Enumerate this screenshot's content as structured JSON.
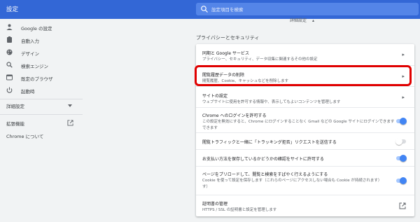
{
  "app": {
    "title": "設定"
  },
  "search": {
    "placeholder": "設定項目を検索",
    "icon": "search-icon"
  },
  "sidebar": {
    "items": [
      {
        "label": "Google の設定",
        "icon": "person-icon"
      },
      {
        "label": "自動入力",
        "icon": "clipboard-icon"
      },
      {
        "label": "デザイン",
        "icon": "palette-icon"
      },
      {
        "label": "検索エンジン",
        "icon": "search-icon"
      },
      {
        "label": "既定のブラウザ",
        "icon": "browser-icon"
      },
      {
        "label": "起動時",
        "icon": "power-icon"
      }
    ],
    "advanced_label": "詳細設定",
    "extensions_label": "拡張機能",
    "about_label": "Chrome について"
  },
  "breadcrumb": {
    "label": "詳細設定",
    "arrow": "▴"
  },
  "privacy": {
    "title": "プライバシーとセキュリティ",
    "rows": [
      {
        "title": "同期と Google サービス",
        "subtitle": "プライバシー、セキュリティ、データ収集に関連するその他の設定",
        "control": "chevron"
      },
      {
        "title": "閲覧履歴データの削除",
        "subtitle": "閲覧履歴、Cookie、キャッシュなどを削除します",
        "control": "chevron",
        "highlighted": true
      },
      {
        "title": "サイトの設定",
        "subtitle": "ウェブサイトに使用を許可する情報や、表示してもよいコンテンツを管理します",
        "control": "chevron"
      },
      {
        "title": "Chrome へのログインを許可する",
        "subtitle": "この設定を無効にすると、Chrome にログインすることなく Gmail などの Google サイトにログインできます",
        "control": "toggle",
        "on": true
      },
      {
        "title": "閲覧トラフィックと一緒に「トラッキング拒否」リクエストを送信する",
        "subtitle": "",
        "control": "toggle",
        "on": false
      },
      {
        "title": "お支払い方法を保存しているかどうかの確認をサイトに許可する",
        "subtitle": "",
        "control": "toggle",
        "on": true
      },
      {
        "title": "ページをプリロードして、閲覧と検索をすばやく行えるようにする",
        "subtitle": "Cookie を使って設定を保存します（これらのページにアクセスしない場合も Cookie が持続されます）",
        "control": "toggle",
        "on": true
      },
      {
        "title": "証明書の管理",
        "subtitle": "HTTPS / SSL の証明書と設定を管理します",
        "control": "external"
      }
    ]
  },
  "colors": {
    "header": "#3367d6",
    "accent": "#4285f4",
    "highlight": "#e00000"
  }
}
